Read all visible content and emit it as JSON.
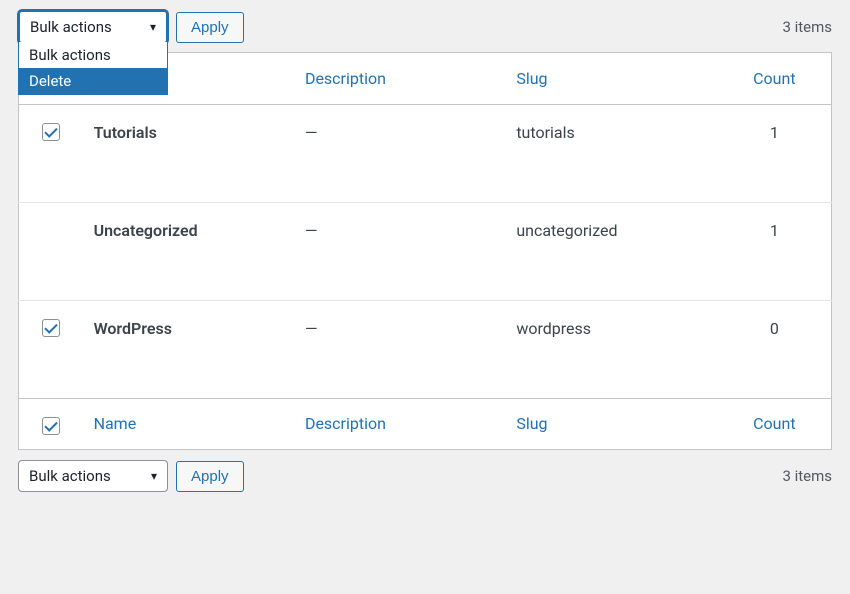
{
  "toolbar": {
    "bulk_label": "Bulk actions",
    "apply_label": "Apply",
    "items_count": "3 items",
    "dropdown": {
      "option1": "Bulk actions",
      "option2": "Delete"
    }
  },
  "table": {
    "headers": {
      "name": "Name",
      "description": "Description",
      "slug": "Slug",
      "count": "Count"
    },
    "rows": [
      {
        "checked": true,
        "name": "Tutorials",
        "description": "—",
        "slug": "tutorials",
        "count": "1"
      },
      {
        "checked": false,
        "name": "Uncategorized",
        "description": "—",
        "slug": "uncategorized",
        "count": "1"
      },
      {
        "checked": true,
        "name": "WordPress",
        "description": "—",
        "slug": "wordpress",
        "count": "0"
      }
    ]
  }
}
